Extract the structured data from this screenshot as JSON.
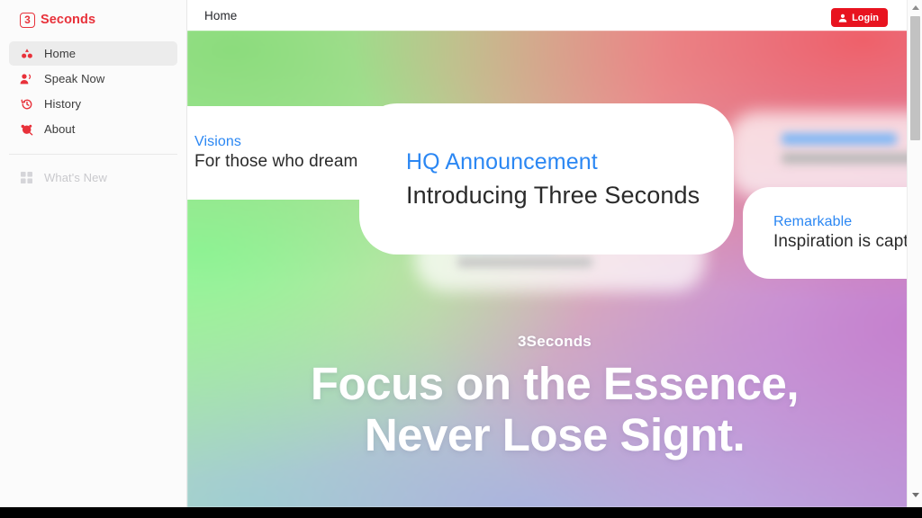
{
  "brand": {
    "mark": "3",
    "name": "Seconds"
  },
  "sidebar": {
    "items": [
      {
        "label": "Home",
        "icon": "home-icon"
      },
      {
        "label": "Speak Now",
        "icon": "speak-now-icon"
      },
      {
        "label": "History",
        "icon": "history-icon"
      },
      {
        "label": "About",
        "icon": "about-icon"
      }
    ],
    "secondary": [
      {
        "label": "What's New",
        "icon": "whats-new-icon"
      }
    ]
  },
  "topbar": {
    "title": "Home",
    "login_label": "Login",
    "login_icon": "user-icon",
    "login_color": "#e8131f"
  },
  "hero": {
    "kicker": "3Seconds",
    "headline_line1": "Focus on the Essence,",
    "headline_line2": "Never Lose Signt."
  },
  "cards": [
    {
      "id": "visions",
      "title": "Visions",
      "subtitle": "For those who dream big"
    },
    {
      "id": "hq-announcement",
      "title": "HQ Announcement",
      "subtitle": "Introducing Three Seconds"
    },
    {
      "id": "remarkable",
      "title": "Remarkable",
      "subtitle": "Inspiration is captured"
    }
  ],
  "colors": {
    "brand_red": "#e8313a",
    "card_title_blue": "#2b87f3",
    "sidebar_bg": "#fbfbfb"
  },
  "scrollbar": {
    "up_arrow": "scroll-up-arrow",
    "down_arrow": "scroll-down-arrow"
  }
}
